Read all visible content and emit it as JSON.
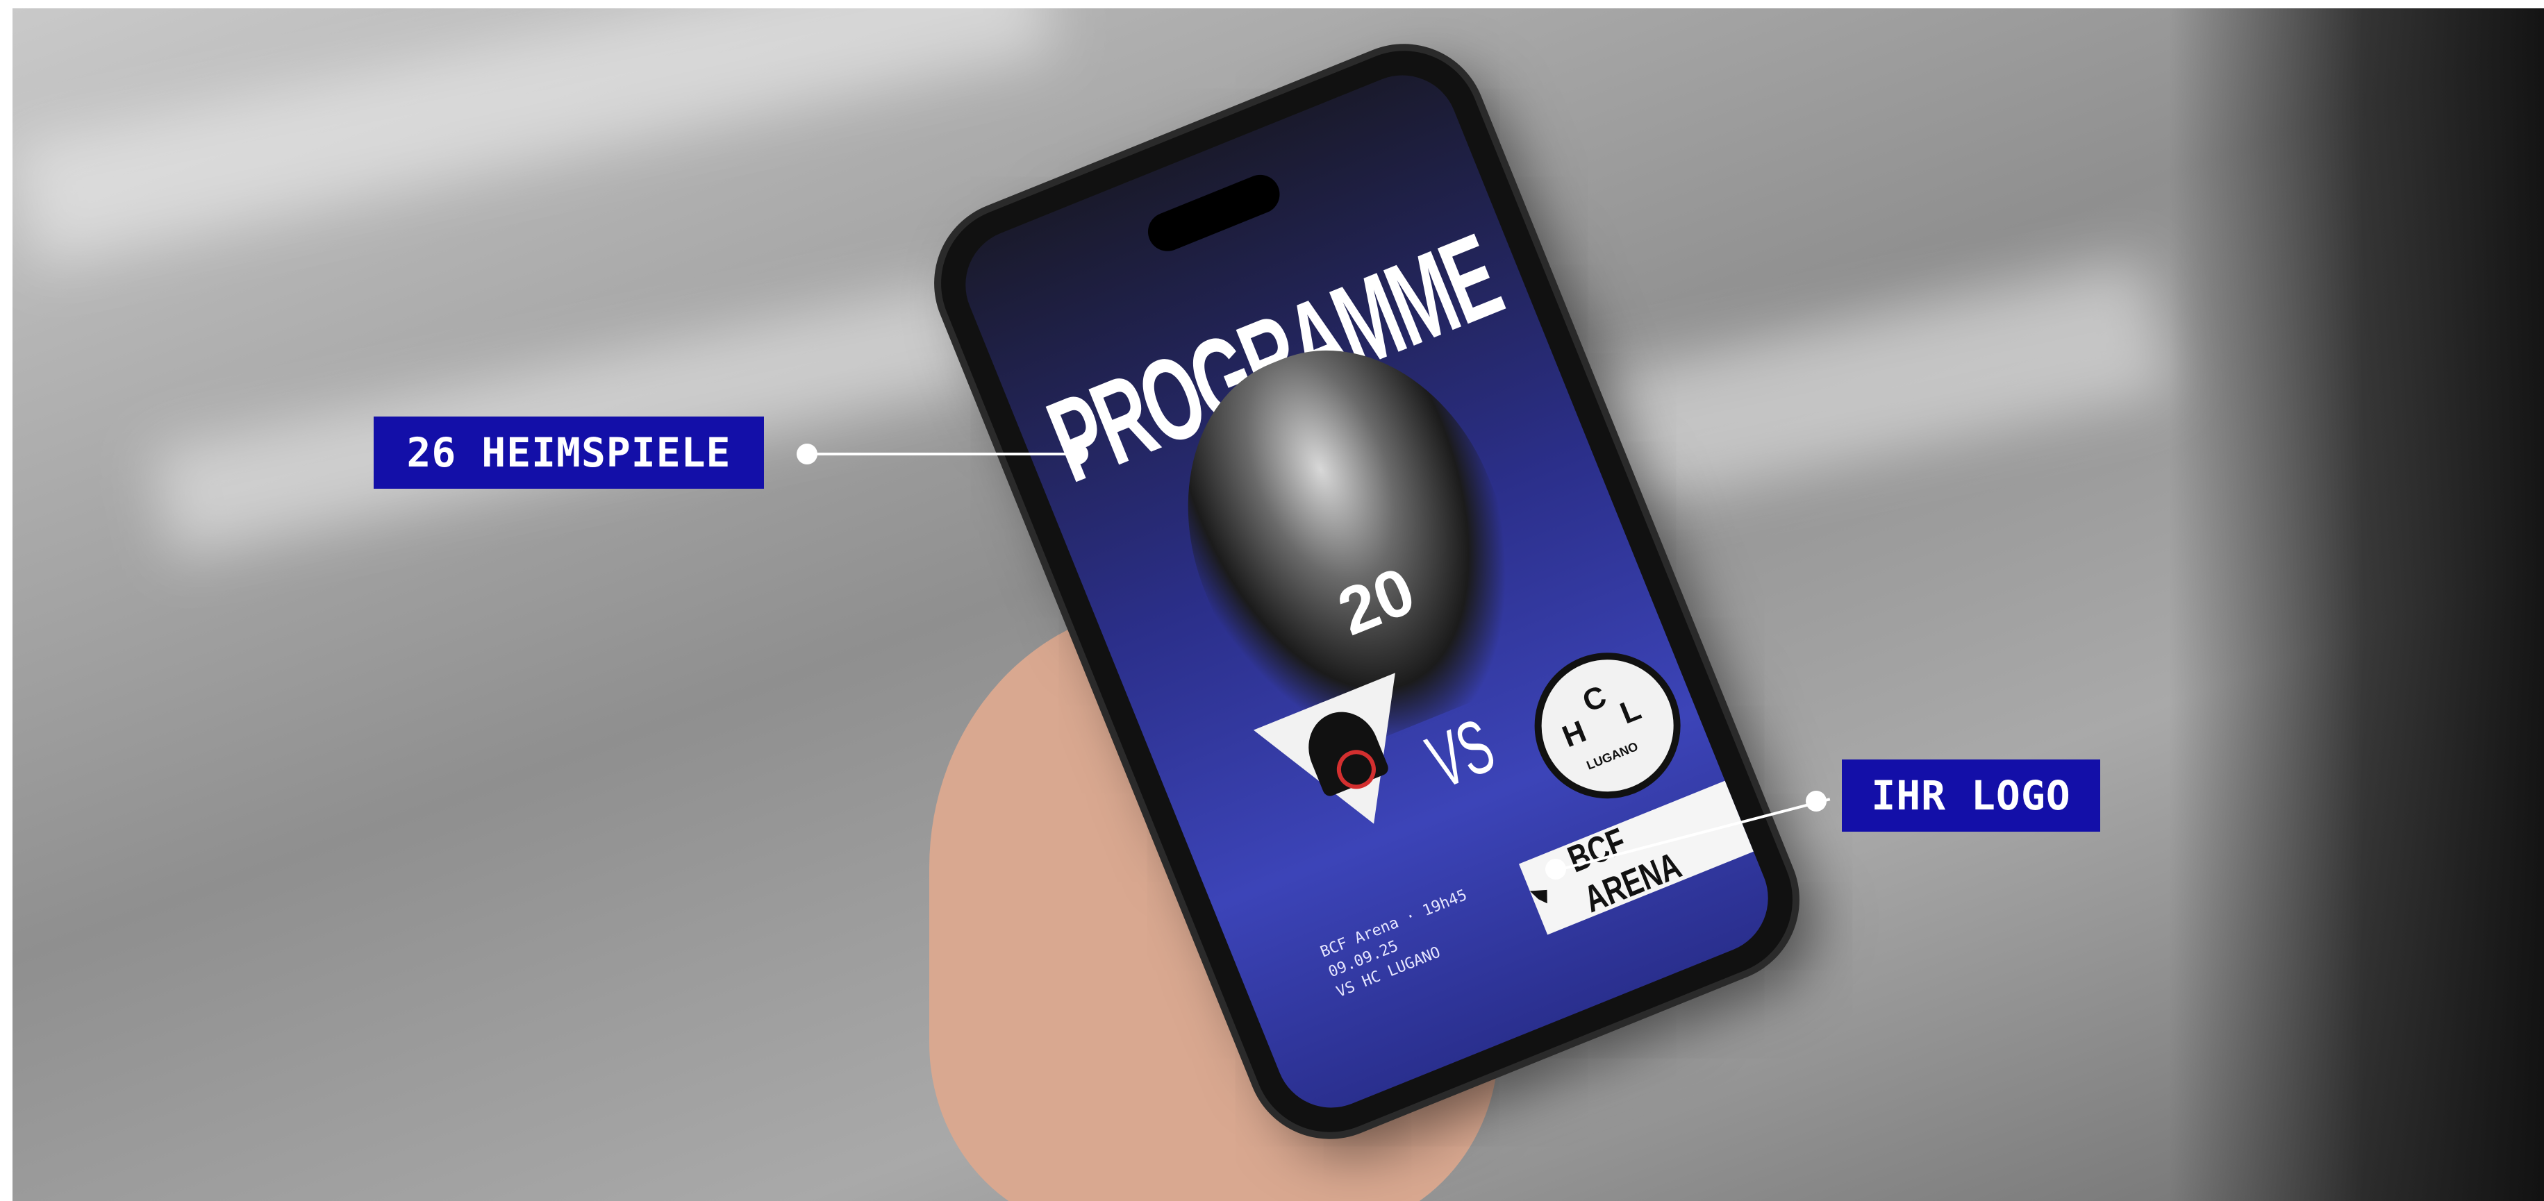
{
  "photo": {
    "phone_screen": {
      "title": "PROGRAMME",
      "jersey_number": "20",
      "vs_text": "VS",
      "away_badge_letters": [
        "H",
        "C",
        "L"
      ],
      "away_badge_caption": "LUGANO",
      "info_lines": [
        "BCF Arena · 19h45",
        "09.09.25",
        "VS HC LUGANO"
      ],
      "sponsor_text": "BCF ARENA"
    }
  },
  "callouts": [
    {
      "label": "26 HEIMSPIELE"
    },
    {
      "label": "IHR LOGO"
    }
  ],
  "colors": {
    "label_background": "#130fa8",
    "label_text": "#ffffff",
    "connector": "#ffffff"
  },
  "icons": [
    "phone-icon",
    "shield-icon",
    "bird-icon",
    "flag-icon"
  ]
}
